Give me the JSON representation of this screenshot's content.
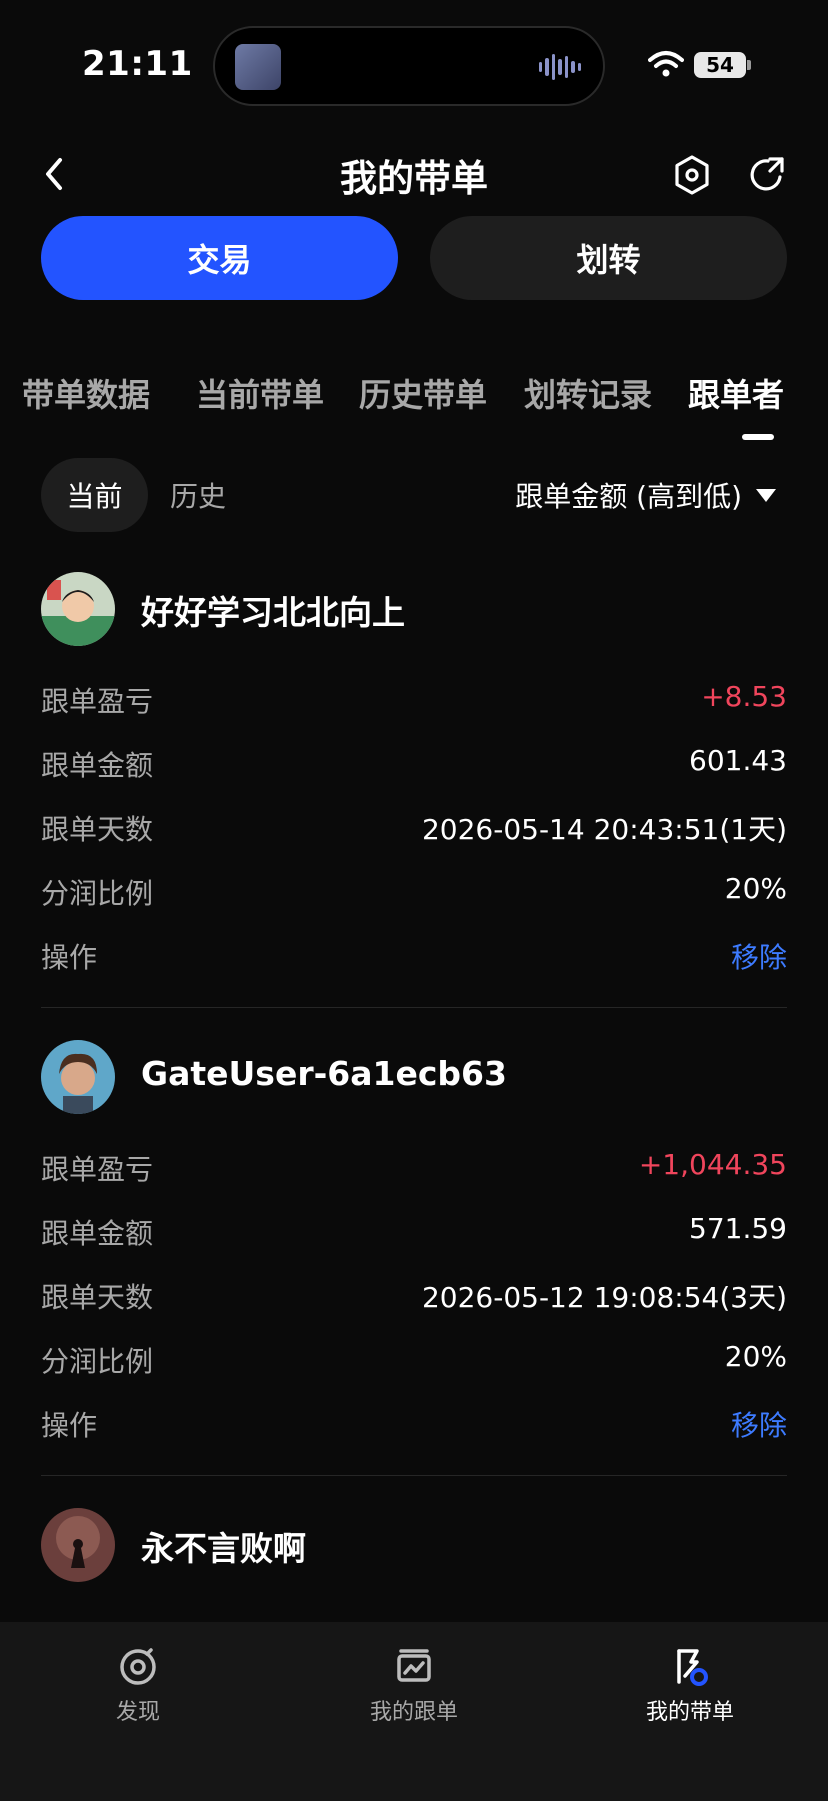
{
  "status_bar": {
    "time": "21:11",
    "battery": "54"
  },
  "header": {
    "title": "我的带单",
    "back_icon": "chevron-left-icon",
    "settings_icon": "hexagon-settings-icon",
    "share_icon": "share-icon"
  },
  "actions": {
    "trade_label": "交易",
    "transfer_label": "划转",
    "accent": "#2354ff"
  },
  "tabs": [
    {
      "label": "带单数据"
    },
    {
      "label": "当前带单"
    },
    {
      "label": "历史带单"
    },
    {
      "label": "划转记录"
    },
    {
      "label": "跟单者",
      "active": true
    }
  ],
  "filter": {
    "current_label": "当前",
    "history_label": "历史",
    "sort_label": "跟单金额 (高到低)"
  },
  "followers": [
    {
      "name": "好好学习北北向上",
      "rows": [
        {
          "label": "跟单盈亏",
          "value": "+8.53",
          "kind": "profit"
        },
        {
          "label": "跟单金额",
          "value": "601.43"
        },
        {
          "label": "跟单天数",
          "value": "2026-05-14 20:43:51(1天)"
        },
        {
          "label": "分润比例",
          "value": "20%"
        },
        {
          "label": "操作",
          "value": "移除",
          "kind": "link"
        }
      ]
    },
    {
      "name": "GateUser-6a1ecb63",
      "rows": [
        {
          "label": "跟单盈亏",
          "value": "+1,044.35",
          "kind": "profit"
        },
        {
          "label": "跟单金额",
          "value": "571.59"
        },
        {
          "label": "跟单天数",
          "value": "2026-05-12 19:08:54(3天)"
        },
        {
          "label": "分润比例",
          "value": "20%"
        },
        {
          "label": "操作",
          "value": "移除",
          "kind": "link"
        }
      ]
    },
    {
      "name": "永不言败啊"
    }
  ],
  "bottom_nav": [
    {
      "label": "发现",
      "icon": "discover-icon"
    },
    {
      "label": "我的跟单",
      "icon": "chart-card-icon"
    },
    {
      "label": "我的带单",
      "icon": "flag-badge-icon",
      "active": true
    }
  ],
  "colors": {
    "profit": "#f0455c",
    "link": "#3d7bff",
    "background": "#0a0a0a"
  }
}
